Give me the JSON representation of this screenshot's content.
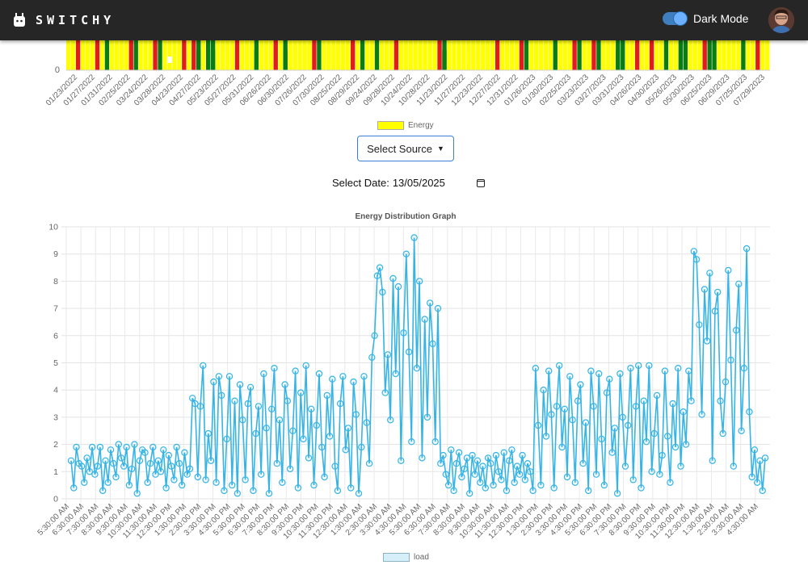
{
  "header": {
    "brand": "SWITCHY",
    "dark_mode_label": "Dark Mode",
    "dark_mode_on": true
  },
  "energy_chart": {
    "legend_label": "Energy",
    "colors": {
      "yellow": "#ffff00",
      "green": "#0a7d12",
      "red": "#e31b1b"
    },
    "x_tick_labels": [
      "01/23/2022",
      "01/27/2022",
      "01/31/2022",
      "02/25/2022",
      "03/24/2022",
      "03/28/2022",
      "04/23/2022",
      "04/27/2022",
      "05/23/2022",
      "05/27/2022",
      "05/31/2022",
      "06/26/2022",
      "06/30/2022",
      "07/26/2022",
      "07/30/2022",
      "08/25/2022",
      "08/29/2022",
      "09/24/2022",
      "09/28/2022",
      "10/24/2022",
      "10/28/2022",
      "11/23/2022",
      "11/27/2022",
      "12/23/2022",
      "12/27/2022",
      "12/31/2022",
      "01/26/2023",
      "01/30/2023",
      "02/25/2023",
      "03/23/2023",
      "03/27/2023",
      "03/31/2023",
      "04/26/2023",
      "04/30/2023",
      "05/26/2023",
      "05/30/2023",
      "06/25/2023",
      "06/29/2023",
      "07/25/2023",
      "07/29/2023"
    ],
    "y_tick_labels": [
      "0"
    ]
  },
  "controls": {
    "select_source_label": "Select Source",
    "select_date_label": "Select Date:",
    "select_date_value": "13/05/2025"
  },
  "chart_data": {
    "type": "line",
    "title": "Energy Distribution Graph",
    "xlabel": "",
    "ylabel": "",
    "ylim": [
      0,
      10
    ],
    "y_ticks": [
      0,
      1,
      2,
      3,
      4,
      5,
      6,
      7,
      8,
      9,
      10
    ],
    "grid": true,
    "legend_position": "bottom",
    "x_tick_labels": [
      "5:30:00 AM",
      "6:30:00 AM",
      "7:30:00 AM",
      "8:30:00 AM",
      "9:30:00 AM",
      "10:30:00 AM",
      "11:30:00 AM",
      "12:30:00 PM",
      "1:30:00 PM",
      "2:30:00 PM",
      "3:30:00 PM",
      "4:30:00 PM",
      "5:30:00 PM",
      "6:30:00 PM",
      "7:30:00 PM",
      "8:30:00 PM",
      "9:30:00 PM",
      "10:30:00 PM",
      "11:30:00 PM",
      "12:30:00 AM",
      "1:30:00 AM",
      "2:30:00 AM",
      "3:30:00 AM",
      "4:30:00 AM",
      "5:30:00 AM",
      "6:30:00 AM",
      "7:30:00 AM",
      "8:30:00 AM",
      "9:30:00 AM",
      "10:30:00 AM",
      "11:30:00 AM",
      "12:30:00 PM",
      "1:30:00 PM",
      "2:30:00 PM",
      "3:30:00 PM",
      "4:30:00 PM",
      "5:30:00 PM",
      "6:30:00 PM",
      "7:30:00 PM",
      "8:30:00 PM",
      "9:30:00 PM",
      "10:30:00 PM",
      "11:30:00 PM",
      "12:30:00 AM",
      "1:30:00 AM",
      "2:30:00 AM",
      "3:30:00 AM",
      "4:30:00 AM"
    ],
    "series": [
      {
        "name": "load",
        "color": "#36b4e6",
        "values": [
          1.4,
          0.4,
          1.9,
          1.3,
          1.2,
          0.6,
          1.5,
          1.0,
          1.9,
          0.9,
          1.2,
          1.9,
          0.3,
          1.4,
          0.6,
          1.8,
          1.3,
          0.8,
          2.0,
          1.5,
          1.2,
          1.9,
          0.5,
          1.1,
          2.0,
          0.2,
          1.4,
          1.8,
          1.7,
          0.6,
          1.3,
          1.9,
          0.9,
          1.4,
          1.0,
          1.8,
          0.4,
          1.6,
          1.2,
          0.7,
          1.9,
          1.3,
          0.5,
          1.7,
          0.9,
          1.1,
          3.7,
          3.5,
          0.8,
          3.4,
          4.9,
          0.7,
          2.4,
          1.4,
          4.3,
          0.6,
          4.5,
          3.8,
          0.3,
          2.2,
          4.5,
          0.5,
          3.6,
          0.2,
          4.2,
          2.9,
          0.7,
          3.5,
          4.1,
          0.3,
          2.4,
          3.4,
          0.9,
          4.6,
          2.6,
          0.2,
          3.3,
          4.8,
          1.3,
          2.9,
          0.6,
          4.2,
          3.6,
          1.1,
          2.5,
          4.7,
          0.4,
          3.9,
          2.2,
          4.9,
          1.5,
          3.3,
          0.5,
          2.7,
          4.6,
          1.9,
          0.8,
          3.8,
          2.3,
          4.4,
          1.2,
          0.3,
          3.5,
          4.5,
          1.8,
          2.6,
          0.4,
          4.3,
          3.1,
          0.2,
          1.9,
          4.5,
          2.8,
          1.3,
          5.2,
          6.0,
          8.2,
          8.5,
          7.6,
          3.9,
          5.3,
          2.9,
          8.1,
          4.6,
          7.8,
          1.4,
          6.1,
          9.0,
          5.4,
          2.1,
          9.6,
          4.8,
          8.0,
          1.5,
          6.6,
          3.0,
          7.2,
          5.7,
          2.1,
          7.0,
          1.3,
          1.6,
          0.9,
          0.5,
          1.8,
          0.3,
          1.3,
          1.7,
          0.8,
          1.1,
          1.5,
          0.2,
          1.6,
          0.9,
          1.4,
          0.6,
          1.2,
          0.4,
          1.5,
          1.3,
          0.5,
          1.6,
          1.0,
          0.7,
          1.7,
          0.3,
          1.4,
          1.8,
          0.6,
          1.2,
          0.9,
          1.6,
          0.7,
          1.3,
          1.0,
          0.3,
          4.8,
          2.7,
          0.5,
          4.0,
          2.3,
          4.7,
          3.1,
          0.4,
          3.4,
          4.9,
          1.9,
          3.3,
          0.8,
          4.5,
          2.9,
          0.6,
          3.6,
          4.2,
          1.3,
          2.8,
          0.3,
          4.7,
          3.4,
          0.9,
          4.6,
          2.2,
          0.5,
          3.9,
          4.4,
          1.7,
          2.6,
          0.2,
          4.6,
          3.0,
          1.2,
          2.7,
          4.8,
          0.7,
          3.4,
          4.9,
          0.4,
          3.6,
          2.1,
          4.9,
          1.0,
          2.4,
          3.8,
          0.9,
          1.6,
          4.7,
          2.3,
          0.6,
          3.5,
          1.9,
          4.8,
          1.2,
          3.2,
          2.0,
          4.7,
          3.6,
          9.1,
          8.8,
          6.4,
          3.1,
          7.7,
          5.8,
          8.3,
          1.4,
          6.9,
          7.6,
          3.6,
          2.4,
          4.3,
          8.4,
          5.1,
          1.2,
          6.2,
          7.9,
          2.5,
          4.8,
          9.2,
          3.2,
          0.8,
          1.8,
          0.6,
          1.4,
          0.3,
          1.5
        ]
      }
    ]
  }
}
